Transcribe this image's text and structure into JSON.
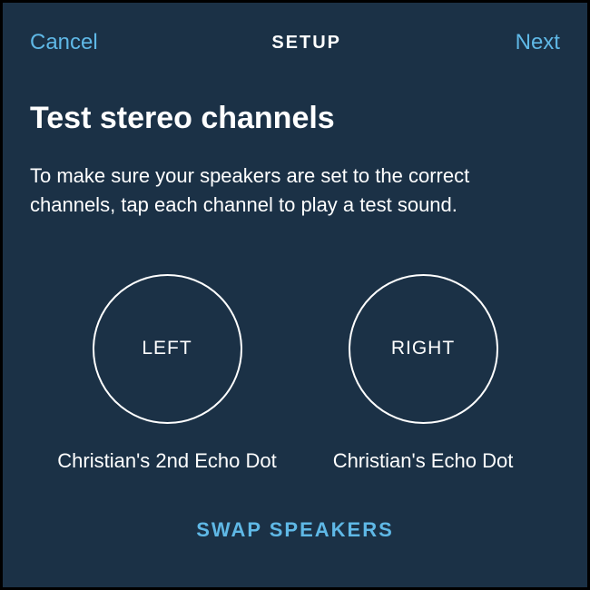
{
  "header": {
    "cancel": "Cancel",
    "title": "SETUP",
    "next": "Next"
  },
  "page": {
    "title": "Test stereo channels",
    "description": "To make sure your speakers are set to the correct channels, tap each channel to play a test sound."
  },
  "channels": {
    "left": {
      "label": "LEFT",
      "device": "Christian's 2nd Echo Dot"
    },
    "right": {
      "label": "RIGHT",
      "device": "Christian's Echo Dot"
    }
  },
  "swap": "SWAP SPEAKERS",
  "colors": {
    "background": "#1b3146",
    "accent": "#5fb8e6",
    "text": "#ffffff"
  }
}
